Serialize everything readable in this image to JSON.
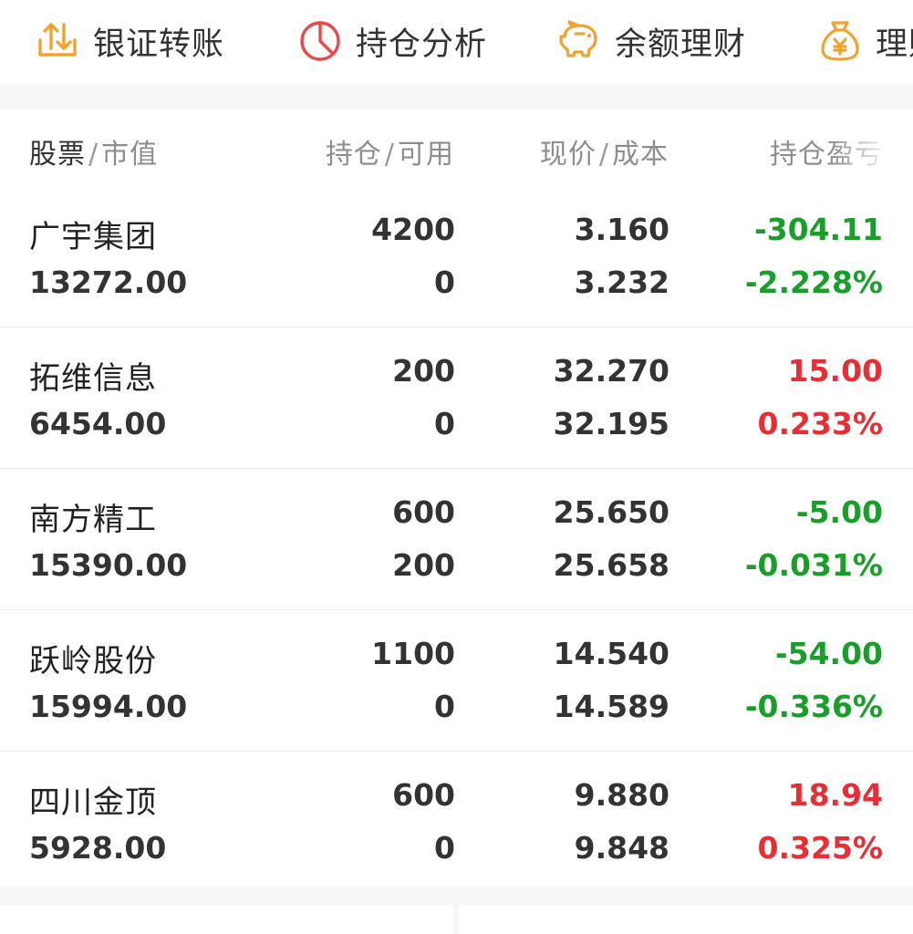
{
  "colors": {
    "gain": "#e62e35",
    "loss": "#1a9e2a",
    "accent": "#f0a22f",
    "chart_icon": "#e64a4a"
  },
  "quick_actions": [
    {
      "label": "银证转账",
      "icon": "transfer-icon"
    },
    {
      "label": "持仓分析",
      "icon": "pie-chart-icon"
    },
    {
      "label": "余额理财",
      "icon": "piggy-bank-icon"
    },
    {
      "label": "理财",
      "icon": "money-bag-icon"
    }
  ],
  "table": {
    "headers": {
      "col1_primary": "股票",
      "col1_secondary": "市值",
      "col2_primary": "持仓",
      "col2_secondary": "可用",
      "col3_primary": "现价",
      "col3_secondary": "成本",
      "col4": "持仓盈亏",
      "separator": "/"
    },
    "rows": [
      {
        "name": "广宇集团",
        "market_value": "13272.00",
        "position": "4200",
        "available": "0",
        "price": "3.160",
        "cost": "3.232",
        "pnl": "-304.11",
        "pnl_pct": "-2.228%",
        "trend": "loss"
      },
      {
        "name": "拓维信息",
        "market_value": "6454.00",
        "position": "200",
        "available": "0",
        "price": "32.270",
        "cost": "32.195",
        "pnl": "15.00",
        "pnl_pct": "0.233%",
        "trend": "gain"
      },
      {
        "name": "南方精工",
        "market_value": "15390.00",
        "position": "600",
        "available": "200",
        "price": "25.650",
        "cost": "25.658",
        "pnl": "-5.00",
        "pnl_pct": "-0.031%",
        "trend": "loss"
      },
      {
        "name": "跃岭股份",
        "market_value": "15994.00",
        "position": "1100",
        "available": "0",
        "price": "14.540",
        "cost": "14.589",
        "pnl": "-54.00",
        "pnl_pct": "-0.336%",
        "trend": "loss"
      },
      {
        "name": "四川金顶",
        "market_value": "5928.00",
        "position": "600",
        "available": "0",
        "price": "9.880",
        "cost": "9.848",
        "pnl": "18.94",
        "pnl_pct": "0.325%",
        "trend": "gain"
      }
    ]
  }
}
